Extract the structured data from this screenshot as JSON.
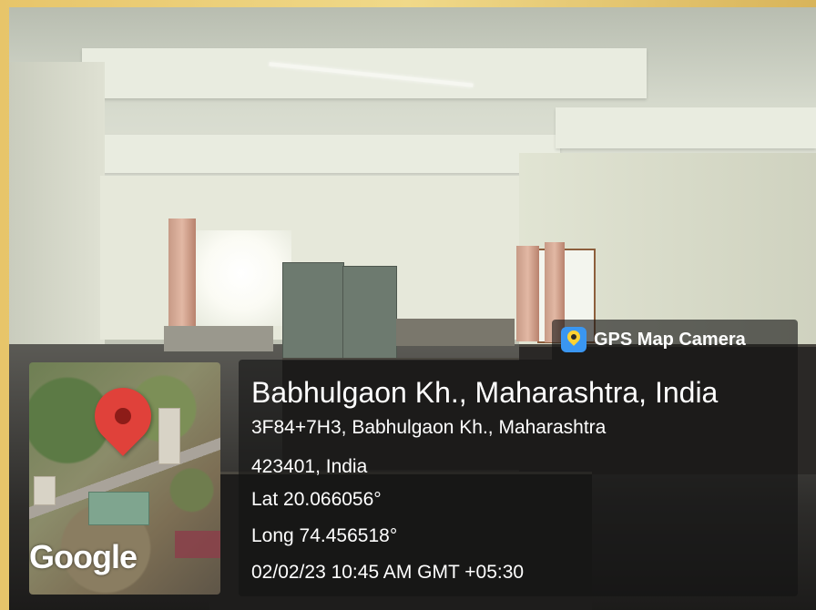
{
  "overlay": {
    "app_badge": "GPS Map Camera",
    "title": "Babhulgaon Kh., Maharashtra, India",
    "address_line1": "3F84+7H3, Babhulgaon Kh., Maharashtra",
    "address_line2": "423401, India",
    "latitude": "Lat 20.066056°",
    "longitude": "Long 74.456518°",
    "datetime": "02/02/23 10:45 AM GMT +05:30"
  },
  "map": {
    "provider_label": "Google",
    "marker_color": "#e0413a"
  },
  "icons": {
    "badge_icon": "location-pin-app-icon",
    "map_marker": "map-pin-icon"
  },
  "colors": {
    "overlay_bg": "rgba(20,20,20,0.62)",
    "badge_icon_bg": "#3a96f1"
  }
}
